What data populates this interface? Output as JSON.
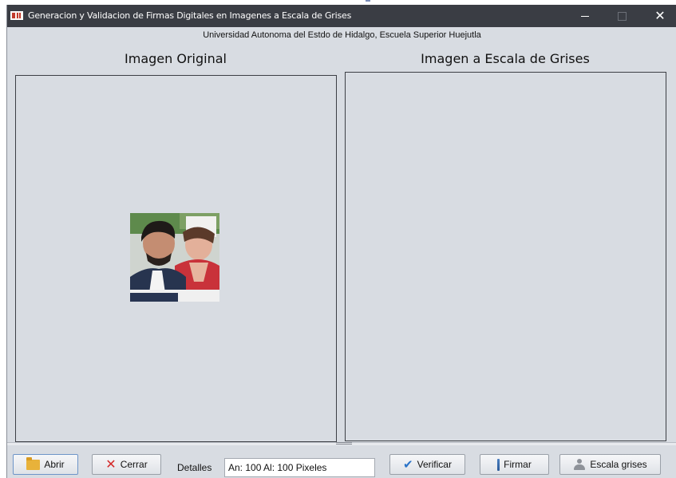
{
  "window": {
    "title": "Generacion y Validacion de Firmas Digitales en Imagenes a Escala de Grises",
    "minimize_glyph": "",
    "maximize_glyph": "",
    "close_glyph": "✕"
  },
  "header": {
    "subtitle": "Universidad Autonoma del Estdo de Hidalgo, Escuela Superior Huejutla"
  },
  "panels": {
    "left_title": "Imagen Original",
    "right_title": "Imagen a Escala de Grises"
  },
  "toolbar": {
    "open_label": "Abrir",
    "close_label": "Cerrar",
    "details_label": "Detalles",
    "details_value": "An: 100  Al: 100  Pixeles",
    "verify_label": "Verificar",
    "sign_label": "Firmar",
    "grayscale_label": "Escala grises"
  },
  "icons": {
    "app": "app-icon",
    "open": "folder-icon",
    "close": "x-icon",
    "verify": "check-icon",
    "sign": "pen-icon",
    "grayscale": "person-icon"
  },
  "colors": {
    "titlebar": "#3a3d44",
    "window_bg": "#d8dce2",
    "accent": "#6e95c8"
  }
}
